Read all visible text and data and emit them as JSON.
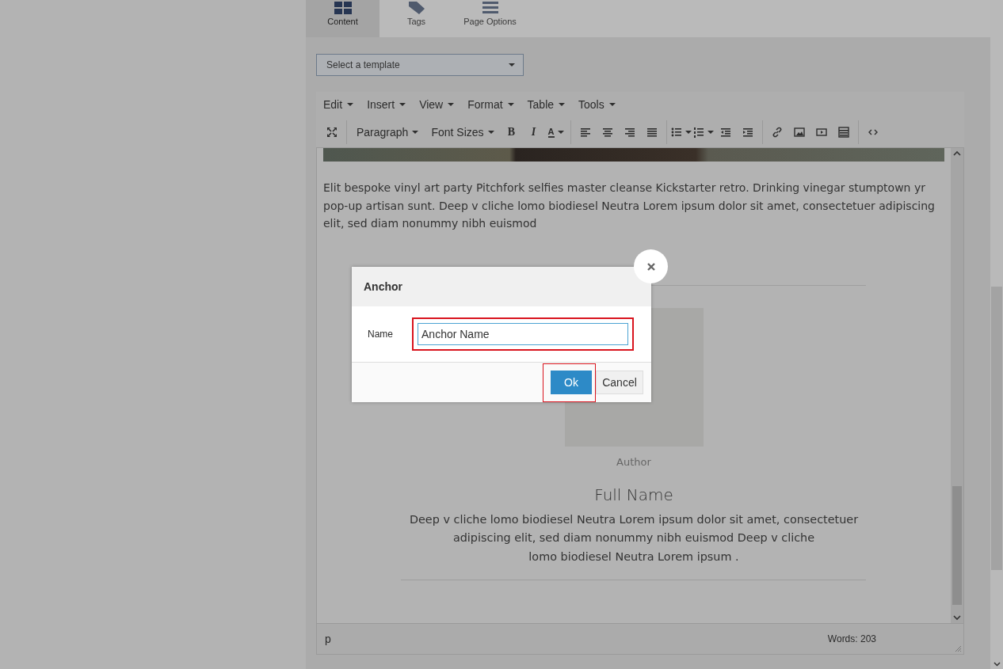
{
  "tabs": [
    {
      "label": "Content",
      "selected": true
    },
    {
      "label": "Tags",
      "selected": false
    },
    {
      "label": "Page Options",
      "selected": false
    }
  ],
  "template_select": {
    "placeholder": "Select a template"
  },
  "menu_bar": [
    "Edit",
    "Insert",
    "View",
    "Format",
    "Table",
    "Tools"
  ],
  "toolbar": {
    "block_format": "Paragraph",
    "font_sizes": "Font Sizes",
    "style_buttons": [
      "B",
      "I",
      "A"
    ]
  },
  "editor": {
    "intro": "Elit bespoke vinyl art party Pitchfork selfies master cleanse Kickstarter retro. Drinking vinegar stumptown yr pop-up artisan sunt. Deep v cliche lomo biodiesel Neutra Lorem ipsum dolor sit amet, consectetuer adipiscing elit, sed diam nonummy nibh euismod",
    "profile": {
      "caption": "Author",
      "name": "Full Name",
      "bio": "Deep v cliche lomo biodiesel Neutra Lorem ipsum dolor sit amet, consectetuer adipiscing elit, sed diam nonummy nibh euismod Deep v cliche\nlomo biodiesel Neutra Lorem ipsum ."
    }
  },
  "status_bar": {
    "path": "p",
    "word_count": "Words: 203"
  },
  "dialog": {
    "title": "Anchor",
    "field_label": "Name",
    "field_value": "Anchor Name",
    "buttons": [
      {
        "label": "Ok",
        "kind": "primary"
      },
      {
        "label": "Cancel",
        "kind": "default"
      }
    ]
  }
}
